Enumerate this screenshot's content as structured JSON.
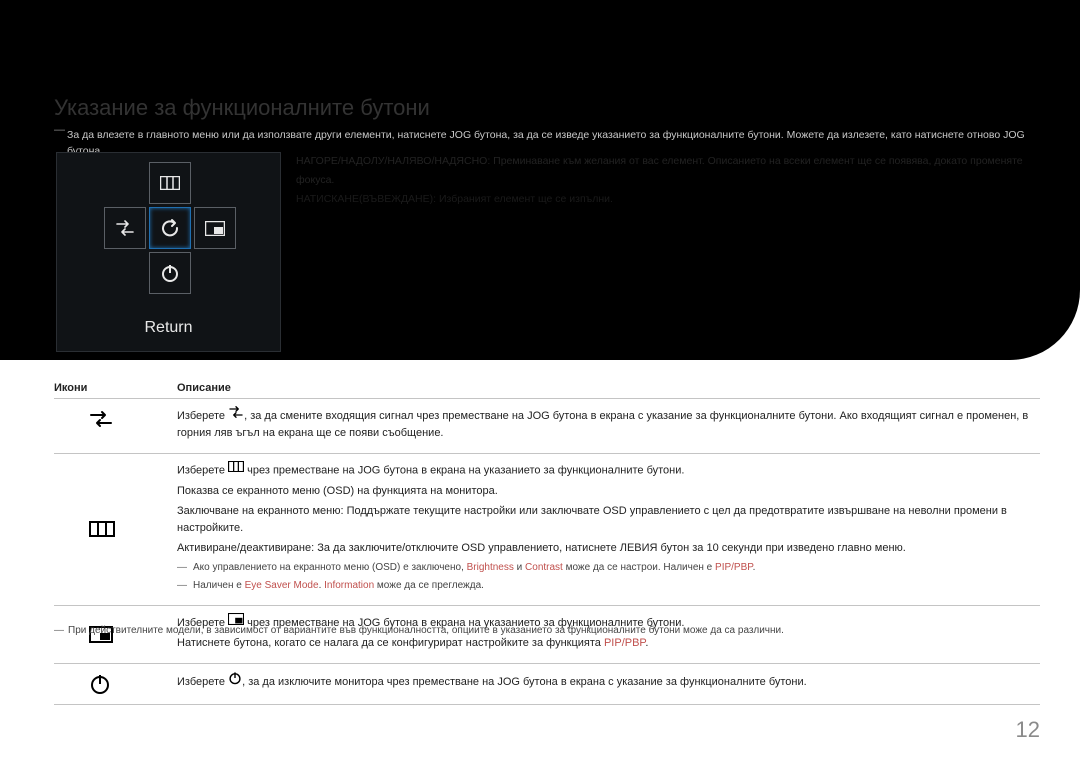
{
  "page": {
    "faded_title": "Указание за функционалните бутони",
    "intro": "За да влезете в главното меню или да използвате други елементи, натиснете JOG бутона, за да се изведе указанието за функционалните бутони. Можете да излезете, като натиснете отново JOG бутона.",
    "panel": {
      "return": "Return"
    },
    "side_faded": {
      "l1": "НАГОРЕ/НАДОЛУ/НАЛЯВО/НАДЯСНО: Преминаване към желания от вас елемент. Описанието на всеки елемент ще се появява, докато променяте фокуса.",
      "l2": "НАТИСКАНЕ(ВЪВЕЖДАНЕ): Избраният елемент ще се изпълни."
    },
    "table": {
      "head_icons": "Икони",
      "head_desc": "Описание",
      "rows": [
        {
          "icon": "source",
          "desc": [
            "Изберете {source}, за да смените входящия сигнал чрез преместване на JOG бутона в екрана с указание за функционалните бутони. Ако входящият сигнал е променен, в горния ляв ъгъл на екрана ще се появи съобщение."
          ]
        },
        {
          "icon": "menu",
          "desc": [
            "Изберете {menu} чрез преместване на JOG бутона в екрана на указанието за функционалните бутони.",
            "Показва се екранното меню (OSD) на функцията на монитора.",
            "Заключване на екранното меню: Поддържате текущите настройки или заключвате OSD управлението с цел да предотвратите извършване на неволни промени в настройките.",
            "Активиране/деактивиране: За да заключите/отключите OSD управлението, натиснете ЛЕВИЯ бутон за 10 секунди при изведено главно меню."
          ],
          "notes": [
            {
              "pre": "Ако управлението на екранното меню (OSD) е заключено, ",
              "hl1": "Brightness",
              "mid1": " и ",
              "hl2": "Contrast",
              "mid2": " може да се настрои. Наличен е ",
              "hl3": "PIP/PBP",
              "post": "."
            },
            {
              "pre": "Наличен е ",
              "hl1": "Eye Saver Mode",
              "mid1": ". ",
              "hl2": "Information",
              "post": " може да се преглежда."
            }
          ]
        },
        {
          "icon": "pip",
          "desc": [
            "Изберете {pip} чрез преместване на JOG бутона в екрана на указанието за функционалните бутони.",
            "Натиснете бутона, когато се налага да се конфигурират настройките за функцията {hl:PIP/PBP}."
          ]
        },
        {
          "icon": "power",
          "desc": [
            "Изберете {power}, за да изключите монитора чрез преместване на JOG бутона в екрана с указание за функционалните бутони."
          ]
        }
      ]
    },
    "footnote": "При действителните модели, в зависимост от вариантите във функционалността, опциите в указанието за функционалните бутони може да са различни.",
    "page_number": "12"
  }
}
